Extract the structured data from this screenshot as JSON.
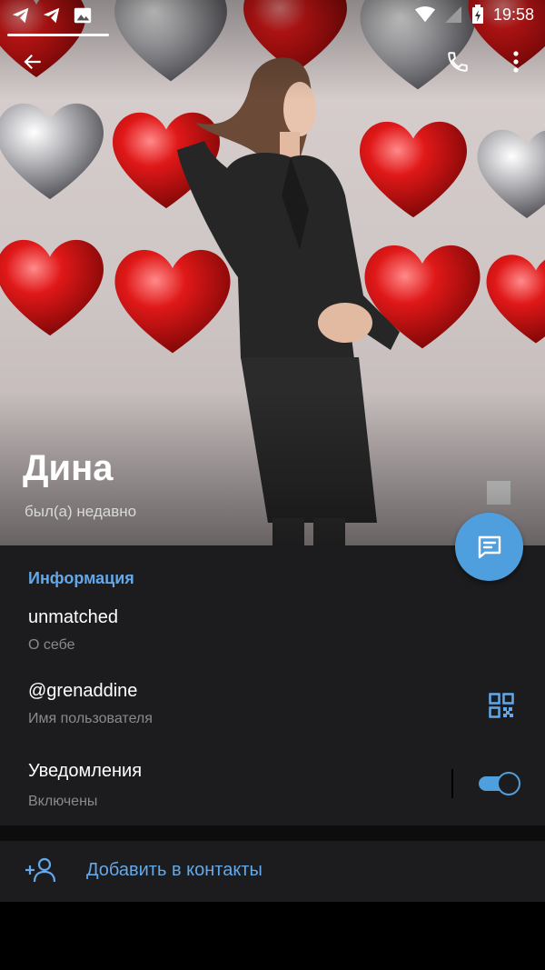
{
  "status_bar": {
    "time": "19:58",
    "left_icons": [
      "telegram-icon",
      "telegram-icon",
      "image-icon"
    ],
    "right_icons": [
      "wifi-icon",
      "signal-icon",
      "battery-charging-icon"
    ]
  },
  "toolbar": {
    "back_icon": "arrow-left-icon",
    "call_icon": "phone-icon",
    "menu_icon": "more-vertical-icon"
  },
  "profile": {
    "name": "Дина",
    "status": "был(а) недавно"
  },
  "info": {
    "title": "Информация",
    "bio_value": "unmatched",
    "bio_label": "О себе",
    "username_value": "@grenaddine",
    "username_label": "Имя пользователя",
    "notifications_value": "Уведомления",
    "notifications_label": "Включены",
    "notifications_enabled": true
  },
  "actions": {
    "add_contact": "Добавить в контакты"
  },
  "colors": {
    "accent": "#62a8ea",
    "fab": "#4f9fdf",
    "panel": "#1c1c1e"
  }
}
